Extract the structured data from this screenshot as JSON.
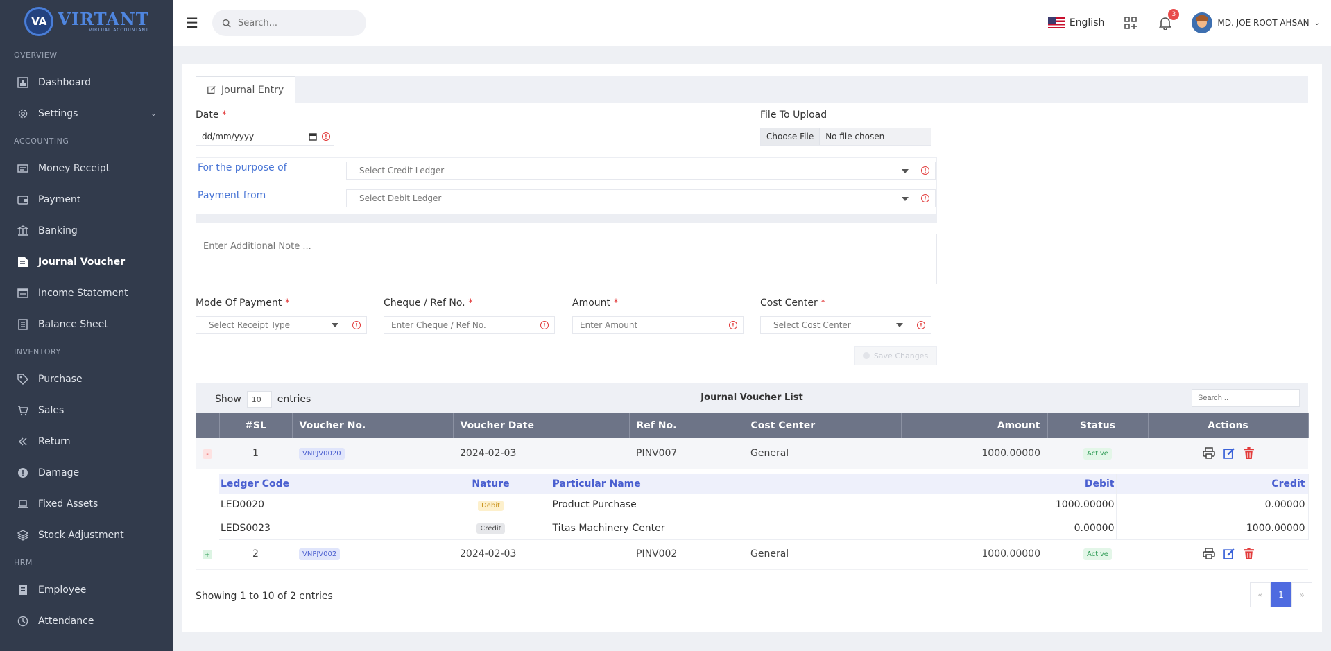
{
  "brand": {
    "badge": "VA",
    "name": "VIRTANT",
    "tagline": "VIRTUAL ACCOUNTANT"
  },
  "sidebar": {
    "sections": [
      {
        "title": "OVERVIEW",
        "items": [
          {
            "label": "Dashboard",
            "icon": "chart-icon"
          },
          {
            "label": "Settings",
            "icon": "gear-icon",
            "chevron": "⌄"
          }
        ]
      },
      {
        "title": "ACCOUNTING",
        "items": [
          {
            "label": "Money Receipt",
            "icon": "receipt-icon"
          },
          {
            "label": "Payment",
            "icon": "wallet-icon"
          },
          {
            "label": "Banking",
            "icon": "bank-icon"
          },
          {
            "label": "Journal Voucher",
            "icon": "journal-icon",
            "active": true
          },
          {
            "label": "Income Statement",
            "icon": "statement-icon"
          },
          {
            "label": "Balance Sheet",
            "icon": "sheet-icon"
          }
        ]
      },
      {
        "title": "INVENTORY",
        "items": [
          {
            "label": "Purchase",
            "icon": "tag-icon"
          },
          {
            "label": "Sales",
            "icon": "cart-icon"
          },
          {
            "label": "Return",
            "icon": "double-chevron-left-icon"
          },
          {
            "label": "Damage",
            "icon": "alert-circle-icon"
          },
          {
            "label": "Fixed Assets",
            "icon": "laptop-icon"
          },
          {
            "label": "Stock Adjustment",
            "icon": "layers-icon"
          }
        ]
      },
      {
        "title": "HRM",
        "items": [
          {
            "label": "Employee",
            "icon": "id-card-icon"
          },
          {
            "label": "Attendance",
            "icon": "clock-icon"
          }
        ]
      }
    ]
  },
  "topbar": {
    "search_placeholder": "Search...",
    "language": "English",
    "notification_count": "3",
    "user_name": "MD. JOE ROOT AHSAN"
  },
  "form": {
    "tab_label": "Journal Entry",
    "date_label": "Date",
    "date_placeholder": "dd/mm/yyyy",
    "file_label": "File To Upload",
    "file_button": "Choose File",
    "file_status": "No file chosen",
    "purpose_label": "For the purpose of",
    "credit_placeholder": "Select Credit Ledger",
    "payment_from_label": "Payment from",
    "debit_placeholder": "Select Debit Ledger",
    "note_placeholder": "Enter Additional Note ...",
    "mode_label": "Mode Of Payment",
    "mode_placeholder": "Select Receipt Type",
    "cheque_label": "Cheque / Ref No.",
    "cheque_placeholder": "Enter Cheque / Ref No.",
    "amount_label": "Amount",
    "amount_placeholder": "Enter Amount",
    "cost_center_label": "Cost Center",
    "cost_center_placeholder": "Select Cost Center",
    "required_mark": "*",
    "save_label": "Save Changes"
  },
  "list": {
    "show_label": "Show",
    "entries_label": "entries",
    "page_size": "10",
    "title": "Journal Voucher List",
    "search_placeholder": "Search ..",
    "columns": [
      "",
      "#SL",
      "Voucher No.",
      "Voucher Date",
      "Ref No.",
      "Cost Center",
      "Amount",
      "Status",
      "Actions"
    ],
    "rows": [
      {
        "toggle": "-",
        "sl": "1",
        "voucher_no": "VNPJV0020",
        "date": "2024-02-03",
        "ref": "PINV007",
        "cost_center": "General",
        "amount": "1000.00000",
        "status": "Active"
      },
      {
        "toggle": "+",
        "sl": "2",
        "voucher_no": "VNPJV002",
        "date": "2024-02-03",
        "ref": "PINV002",
        "cost_center": "General",
        "amount": "1000.00000",
        "status": "Active"
      }
    ],
    "detail": {
      "columns": [
        "Ledger Code",
        "Nature",
        "Particular Name",
        "Debit",
        "Credit"
      ],
      "rows": [
        {
          "code": "LED0020",
          "nature": "Debit",
          "particular": "Product Purchase",
          "debit": "1000.00000",
          "credit": "0.00000"
        },
        {
          "code": "LEDS0023",
          "nature": "Credit",
          "particular": "Titas Machinery Center",
          "debit": "0.00000",
          "credit": "1000.00000"
        }
      ]
    },
    "summary": "Showing 1 to 10 of 2 entries",
    "pager": {
      "prev": "«",
      "current": "1",
      "next": "»"
    }
  },
  "colors": {
    "sidebar": "#323b4c",
    "table_header": "#6d7487",
    "accent": "#4f6be0",
    "danger": "#e23b3b",
    "link": "#4a76d6"
  }
}
